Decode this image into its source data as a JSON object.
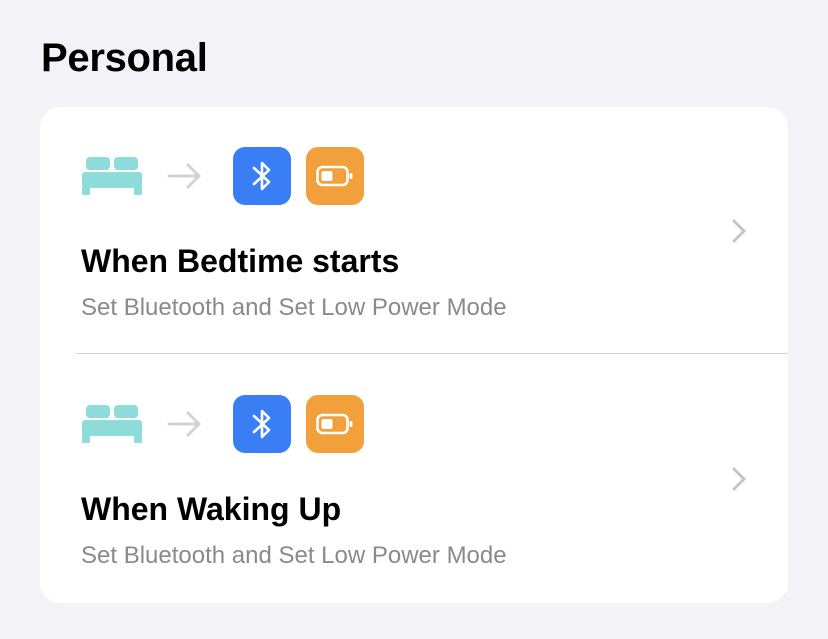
{
  "section": {
    "title": "Personal"
  },
  "automations": [
    {
      "title": "When Bedtime starts",
      "subtitle": "Set Bluetooth and Set Low Power Mode",
      "trigger_icon": "bed-icon",
      "action_icons": [
        "bluetooth-icon",
        "battery-icon"
      ]
    },
    {
      "title": "When Waking Up",
      "subtitle": "Set Bluetooth and Set Low Power Mode",
      "trigger_icon": "bed-icon",
      "action_icons": [
        "bluetooth-icon",
        "battery-icon"
      ]
    }
  ],
  "colors": {
    "background": "#f2f2f7",
    "card": "#ffffff",
    "bed": "#8ddcd9",
    "bluetooth_tile": "#3a7ef5",
    "battery_tile": "#f2a03b",
    "subtitle": "#8a8a8e",
    "chevron": "#c4c4c7"
  }
}
